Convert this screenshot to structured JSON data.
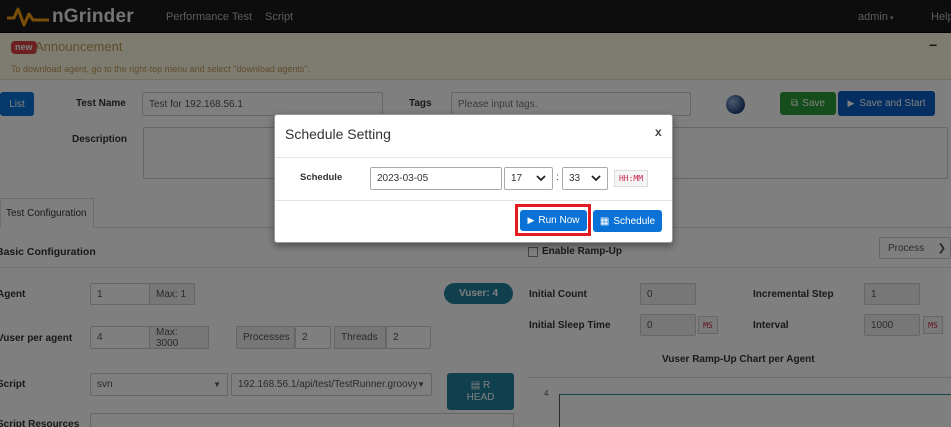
{
  "navbar": {
    "brand": "nGrinder",
    "links": [
      "Performance Test",
      "Script"
    ],
    "user": "admin",
    "user_caret": "▾",
    "help": "Help"
  },
  "announcement": {
    "badge": "new",
    "title": "Announcement",
    "minimize": "−",
    "text": "To download agent, go to the right-top menu and select \"download agents\"."
  },
  "test": {
    "list_button": "List",
    "name_label": "Test Name",
    "name_value": "Test for 192.168.56.1",
    "tags_label": "Tags",
    "tags_placeholder": "Please input tags.",
    "save_button": "Save",
    "save_start_button": "Save and Start",
    "description_label": "Description"
  },
  "tabs": {
    "config": "Test Configuration"
  },
  "basic": {
    "title": "Basic Configuration",
    "agent_label": "Agent",
    "agent_value": "1",
    "agent_max": "Max: 1",
    "vuser_badge": "Vuser: 4",
    "vuser_label": "Vuser per agent",
    "vuser_value": "4",
    "vuser_max": "Max: 3000",
    "processes_label": "Processes",
    "processes_value": "2",
    "threads_label": "Threads",
    "threads_value": "2",
    "script_label": "Script",
    "script_type": "svn",
    "script_path": "192.168.56.1/api/test/TestRunner.groovy",
    "script_btn_line1": "R",
    "script_btn_line2": "HEAD",
    "resources_label": "Script Resources"
  },
  "rampup": {
    "enable_label": "Enable Ramp-Up",
    "type_select": "Process",
    "initial_count_label": "Initial Count",
    "initial_count_value": "0",
    "incremental_step_label": "Incremental Step",
    "incremental_step_value": "1",
    "initial_sleep_label": "Initial Sleep Time",
    "initial_sleep_value": "0",
    "interval_label": "Interval",
    "interval_value": "1000",
    "ms_unit": "MS",
    "chart_title": "Vuser Ramp-Up Chart per Agent",
    "chart_y_tick": "4"
  },
  "modal": {
    "title": "Schedule Setting",
    "close": "x",
    "schedule_label": "Schedule",
    "date_value": "2023-03-05",
    "hour_value": "17",
    "colon": ":",
    "minute_value": "33",
    "time_hint": "HH:MM",
    "run_now_button": "Run Now",
    "schedule_button": "Schedule"
  },
  "colors": {
    "primary": "#0a72d6",
    "success": "#2d9a39",
    "teal": "#20809a",
    "highlight": "#e01b22"
  }
}
